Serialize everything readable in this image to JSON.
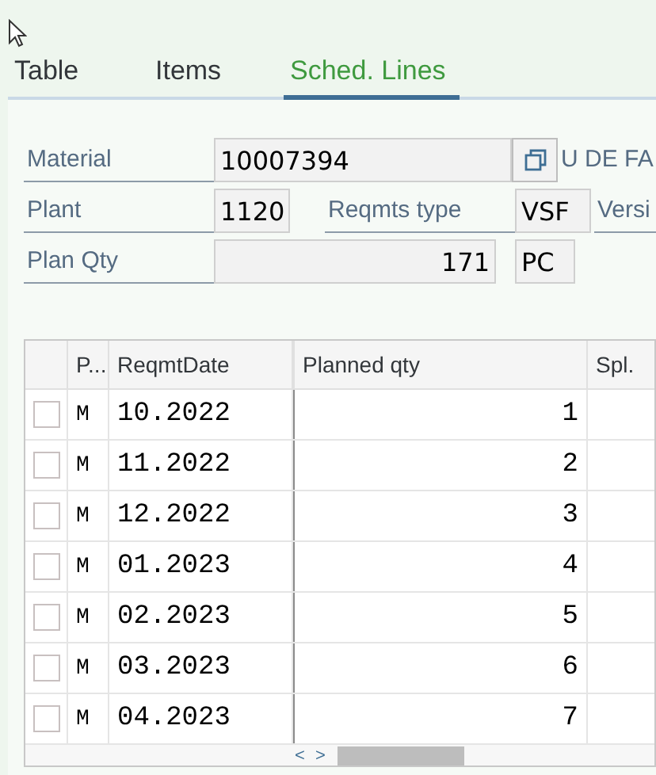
{
  "tabs": [
    {
      "label": "Table",
      "selected": false
    },
    {
      "label": "Items",
      "selected": false
    },
    {
      "label": "Sched. Lines",
      "selected": true
    }
  ],
  "form": {
    "material": {
      "label": "Material",
      "value": "10007394",
      "description": "U DE FA"
    },
    "plant": {
      "label": "Plant",
      "value": "1120"
    },
    "reqmts_type": {
      "label": "Reqmts type",
      "value": "VSF"
    },
    "version": {
      "label": "Versi"
    },
    "plan_qty": {
      "label": "Plan Qty",
      "value": "171",
      "unit": "PC"
    }
  },
  "table": {
    "columns": [
      "P...",
      "ReqmtDate",
      "Planned qty",
      "Spl."
    ],
    "rows": [
      {
        "selected": false,
        "p": "M",
        "date": "10.2022",
        "qty": "1"
      },
      {
        "selected": false,
        "p": "M",
        "date": "11.2022",
        "qty": "2"
      },
      {
        "selected": false,
        "p": "M",
        "date": "12.2022",
        "qty": "3"
      },
      {
        "selected": false,
        "p": "M",
        "date": "01.2023",
        "qty": "4"
      },
      {
        "selected": false,
        "p": "M",
        "date": "02.2023",
        "qty": "5"
      },
      {
        "selected": false,
        "p": "M",
        "date": "03.2023",
        "qty": "6"
      },
      {
        "selected": false,
        "p": "M",
        "date": "04.2023",
        "qty": "7"
      }
    ],
    "scroll_arrows": {
      "left": "<",
      "right": ">"
    }
  }
}
